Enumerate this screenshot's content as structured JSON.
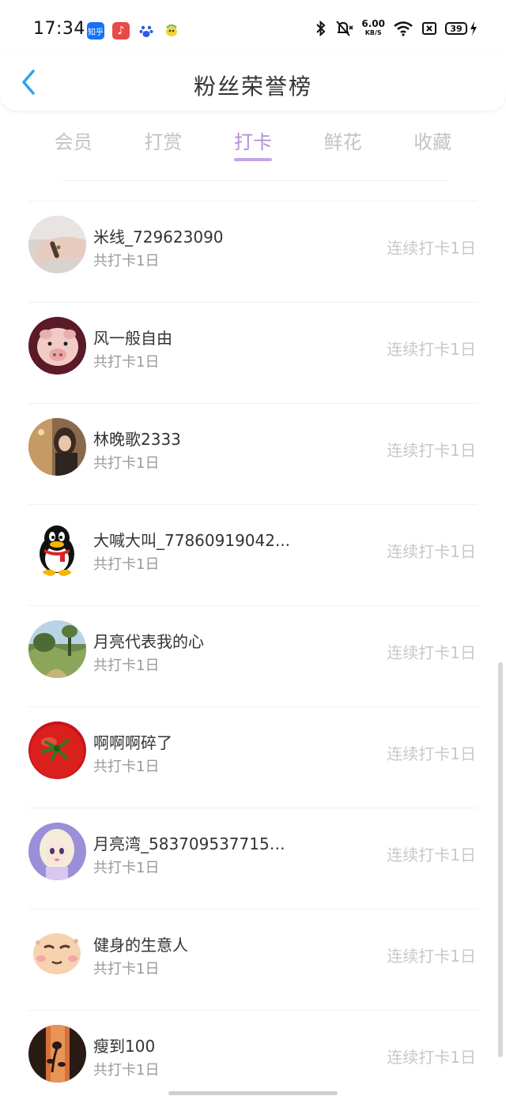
{
  "status_bar": {
    "time": "17:34",
    "apps": [
      {
        "icon": "zhihu-icon",
        "label": "知乎",
        "color": "#1772f6"
      },
      {
        "icon": "music-icon",
        "label": "♪",
        "color": "#e84a4a"
      },
      {
        "icon": "baidu-icon",
        "label": "",
        "color": "#2d5be3"
      },
      {
        "icon": "bird-icon",
        "label": "",
        "color": "#7cc042"
      }
    ],
    "net_speed": "6.00",
    "net_unit": "KB/S",
    "battery": "39"
  },
  "header": {
    "title": "粉丝荣誉榜"
  },
  "tabs": [
    {
      "label": "会员",
      "active": false
    },
    {
      "label": "打赏",
      "active": false
    },
    {
      "label": "打卡",
      "active": true
    },
    {
      "label": "鲜花",
      "active": false
    },
    {
      "label": "收藏",
      "active": false
    }
  ],
  "fans": [
    {
      "name": "米线_729623090",
      "total": "共打卡1日",
      "streak": "连续打卡1日",
      "avatar": "wrist-photo"
    },
    {
      "name": "风一般自由",
      "total": "共打卡1日",
      "streak": "连续打卡1日",
      "avatar": "pig-photo"
    },
    {
      "name": "林晚歌2333",
      "total": "共打卡1日",
      "streak": "连续打卡1日",
      "avatar": "girl-photo"
    },
    {
      "name": "大喊大叫_77860919042...",
      "total": "共打卡1日",
      "streak": "连续打卡1日",
      "avatar": "qq-penguin"
    },
    {
      "name": "月亮代表我的心",
      "total": "共打卡1日",
      "streak": "连续打卡1日",
      "avatar": "landscape-photo"
    },
    {
      "name": "啊啊啊碎了",
      "total": "共打卡1日",
      "streak": "连续打卡1日",
      "avatar": "tomato-photo"
    },
    {
      "name": "月亮湾_5837095377154...",
      "total": "共打卡1日",
      "streak": "连续打卡1日",
      "avatar": "doll-photo"
    },
    {
      "name": "健身的生意人",
      "total": "共打卡1日",
      "streak": "连续打卡1日",
      "avatar": "cartoon-face"
    },
    {
      "name": "瘦到100",
      "total": "共打卡1日",
      "streak": "连续打卡1日",
      "avatar": "flower-shadow-photo"
    }
  ],
  "colors": {
    "accent": "#b48fd8",
    "back_arrow": "#2aa5f0",
    "inactive_tab": "#c3c3c3",
    "streak_text": "#c8c8c8"
  }
}
